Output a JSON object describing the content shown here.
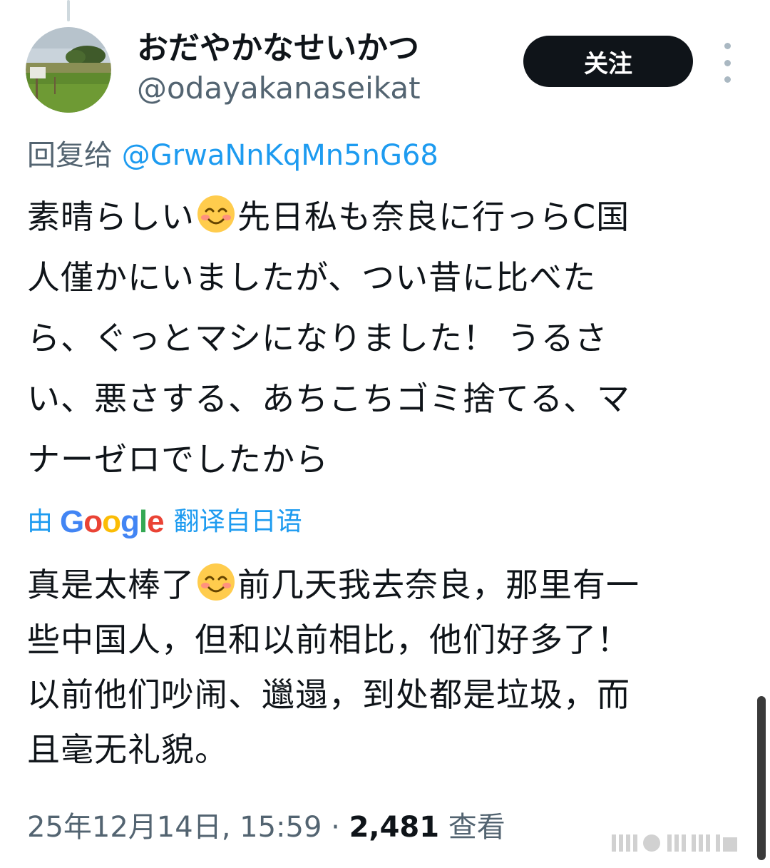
{
  "tweet": {
    "author": {
      "display_name": "おだやかなせいかつ",
      "handle": "@odayakanaseikat"
    },
    "follow_label": "关注",
    "reply": {
      "prefix": "回复给 ",
      "mention": "@GrwaNnKqMn5nG68"
    },
    "original_text": {
      "before_emoji": "素晴らしい",
      "after_emoji": "先日私も奈良に行っらC国\n人僅かにいましたが、つい昔に比べた\nら、ぐっとマシになりました！ うるさ\nい、悪さする、あちこちゴミ捨てる、マ\nナーゼロでしたから"
    },
    "translation": {
      "prefix": "由",
      "google_letters": [
        "G",
        "o",
        "o",
        "g",
        "l",
        "e"
      ],
      "link_label": "翻译自日语"
    },
    "translated_text": {
      "before_emoji": "真是太棒了",
      "after_emoji": "前几天我去奈良，那里有一\n些中国人，但和以前相比，他们好多了！\n以前他们吵闹、邋遢，到处都是垃圾，而\n且毫无礼貌。"
    },
    "meta": {
      "timestamp": "25年12月14日, 15:59",
      "separator": " · ",
      "views_count": "2,481",
      "views_label": " 查看"
    }
  },
  "icons": {
    "more": "more-vertical-icon",
    "emoji": "smiling-face-emoji-icon"
  },
  "colors": {
    "text": "#0f1419",
    "secondary": "#536471",
    "link": "#1d9bf0",
    "button": "#0f1419"
  }
}
